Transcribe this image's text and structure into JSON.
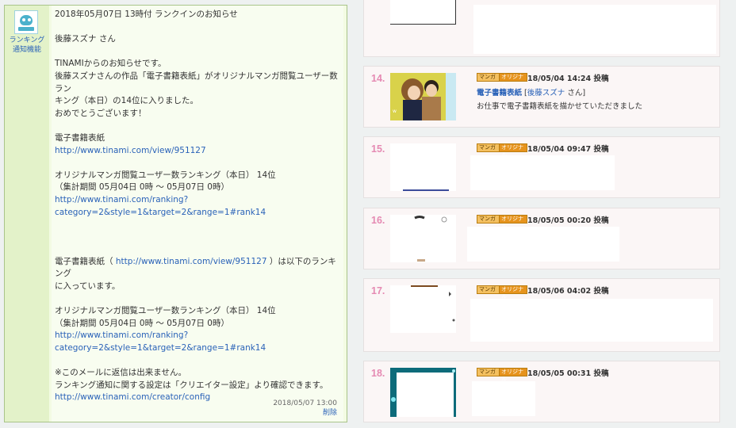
{
  "mail": {
    "sender_name": "ランキング\n通知機能",
    "lines": [
      {
        "text": "2018年05月07日 13時付 ランクインのお知らせ"
      },
      {
        "text": ""
      },
      {
        "text": "後藤スズナ さん"
      },
      {
        "text": ""
      },
      {
        "text": "TINAMIからのお知らせです。"
      },
      {
        "text": "後藤スズナさんの作品「電子書籍表紙」がオリジナルマンガ閲覧ユーザー数ラン"
      },
      {
        "text": "キング（本日）の14位に入りました。"
      },
      {
        "text": "おめでとうございます！"
      },
      {
        "text": ""
      },
      {
        "text": "電子書籍表紙"
      },
      {
        "text": "http://www.tinami.com/view/951127",
        "link": true
      },
      {
        "text": ""
      },
      {
        "text": "オリジナルマンガ閲覧ユーザー数ランキング（本日） 14位"
      },
      {
        "text": "（集計期間 05月04日 0時 〜 05月07日 0時）"
      },
      {
        "text": "http://www.tinami.com/ranking?",
        "link": true
      },
      {
        "text": "category=2&style=1&target=2&range=1#rank14",
        "link": true
      },
      {
        "text": ""
      },
      {
        "text": ""
      },
      {
        "text": ""
      },
      {
        "text": "電子書籍表紙（ http://www.tinami.com/view/951127 ）は以下のランキング"
      },
      {
        "text": "に入っています。"
      },
      {
        "text": ""
      },
      {
        "text": "オリジナルマンガ閲覧ユーザー数ランキング（本日） 14位"
      },
      {
        "text": "（集計期間 05月04日 0時 〜 05月07日 0時）"
      },
      {
        "text": "http://www.tinami.com/ranking?",
        "link": true
      },
      {
        "text": "category=2&style=1&target=2&range=1#rank14",
        "link": true
      },
      {
        "text": ""
      },
      {
        "text": "※このメールに返信は出来ません。"
      },
      {
        "text": "ランキング通知に関する設定は「クリエイター設定」より確認できます。"
      },
      {
        "text": "http://www.tinami.com/creator/config",
        "link": true
      }
    ],
    "date": "2018/05/07 13:00",
    "delete_label": "削除"
  },
  "ranking": {
    "items": [
      {
        "rank": "14.",
        "badge_manga": "マンガ",
        "badge_original": "オリジナル",
        "posted": "18/05/04 14:24 投稿",
        "title": "電子書籍表紙",
        "author": "後藤スズナ",
        "author_suffix": "さん]",
        "bracket": "[",
        "description": "お仕事で電子書籍表紙を描かせていただきました"
      },
      {
        "rank": "15.",
        "badge_manga": "マンガ",
        "badge_original": "オリジナル",
        "posted": "18/05/04 09:47 投稿"
      },
      {
        "rank": "16.",
        "badge_manga": "マンガ",
        "badge_original": "オリジナル",
        "posted": "18/05/05 00:20 投稿"
      },
      {
        "rank": "17.",
        "badge_manga": "マンガ",
        "badge_original": "オリジナル",
        "posted": "18/05/06 04:02 投稿"
      },
      {
        "rank": "18.",
        "badge_manga": "マンガ",
        "badge_original": "オリジナル",
        "posted": "18/05/05 00:31 投稿"
      }
    ]
  },
  "colors": {
    "rank": "#e58ab3",
    "link": "#2a62b8",
    "mail_bg": "#f3fbe3"
  }
}
